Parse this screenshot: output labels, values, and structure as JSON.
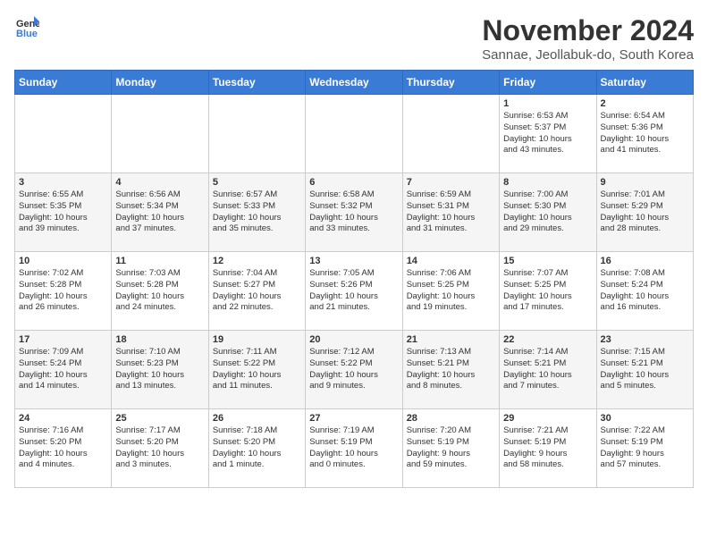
{
  "logo": {
    "general": "General",
    "blue": "Blue"
  },
  "header": {
    "month": "November 2024",
    "location": "Sannae, Jeollabuk-do, South Korea"
  },
  "weekdays": [
    "Sunday",
    "Monday",
    "Tuesday",
    "Wednesday",
    "Thursday",
    "Friday",
    "Saturday"
  ],
  "weeks": [
    [
      {
        "day": "",
        "info": ""
      },
      {
        "day": "",
        "info": ""
      },
      {
        "day": "",
        "info": ""
      },
      {
        "day": "",
        "info": ""
      },
      {
        "day": "",
        "info": ""
      },
      {
        "day": "1",
        "info": "Sunrise: 6:53 AM\nSunset: 5:37 PM\nDaylight: 10 hours\nand 43 minutes."
      },
      {
        "day": "2",
        "info": "Sunrise: 6:54 AM\nSunset: 5:36 PM\nDaylight: 10 hours\nand 41 minutes."
      }
    ],
    [
      {
        "day": "3",
        "info": "Sunrise: 6:55 AM\nSunset: 5:35 PM\nDaylight: 10 hours\nand 39 minutes."
      },
      {
        "day": "4",
        "info": "Sunrise: 6:56 AM\nSunset: 5:34 PM\nDaylight: 10 hours\nand 37 minutes."
      },
      {
        "day": "5",
        "info": "Sunrise: 6:57 AM\nSunset: 5:33 PM\nDaylight: 10 hours\nand 35 minutes."
      },
      {
        "day": "6",
        "info": "Sunrise: 6:58 AM\nSunset: 5:32 PM\nDaylight: 10 hours\nand 33 minutes."
      },
      {
        "day": "7",
        "info": "Sunrise: 6:59 AM\nSunset: 5:31 PM\nDaylight: 10 hours\nand 31 minutes."
      },
      {
        "day": "8",
        "info": "Sunrise: 7:00 AM\nSunset: 5:30 PM\nDaylight: 10 hours\nand 29 minutes."
      },
      {
        "day": "9",
        "info": "Sunrise: 7:01 AM\nSunset: 5:29 PM\nDaylight: 10 hours\nand 28 minutes."
      }
    ],
    [
      {
        "day": "10",
        "info": "Sunrise: 7:02 AM\nSunset: 5:28 PM\nDaylight: 10 hours\nand 26 minutes."
      },
      {
        "day": "11",
        "info": "Sunrise: 7:03 AM\nSunset: 5:28 PM\nDaylight: 10 hours\nand 24 minutes."
      },
      {
        "day": "12",
        "info": "Sunrise: 7:04 AM\nSunset: 5:27 PM\nDaylight: 10 hours\nand 22 minutes."
      },
      {
        "day": "13",
        "info": "Sunrise: 7:05 AM\nSunset: 5:26 PM\nDaylight: 10 hours\nand 21 minutes."
      },
      {
        "day": "14",
        "info": "Sunrise: 7:06 AM\nSunset: 5:25 PM\nDaylight: 10 hours\nand 19 minutes."
      },
      {
        "day": "15",
        "info": "Sunrise: 7:07 AM\nSunset: 5:25 PM\nDaylight: 10 hours\nand 17 minutes."
      },
      {
        "day": "16",
        "info": "Sunrise: 7:08 AM\nSunset: 5:24 PM\nDaylight: 10 hours\nand 16 minutes."
      }
    ],
    [
      {
        "day": "17",
        "info": "Sunrise: 7:09 AM\nSunset: 5:24 PM\nDaylight: 10 hours\nand 14 minutes."
      },
      {
        "day": "18",
        "info": "Sunrise: 7:10 AM\nSunset: 5:23 PM\nDaylight: 10 hours\nand 13 minutes."
      },
      {
        "day": "19",
        "info": "Sunrise: 7:11 AM\nSunset: 5:22 PM\nDaylight: 10 hours\nand 11 minutes."
      },
      {
        "day": "20",
        "info": "Sunrise: 7:12 AM\nSunset: 5:22 PM\nDaylight: 10 hours\nand 9 minutes."
      },
      {
        "day": "21",
        "info": "Sunrise: 7:13 AM\nSunset: 5:21 PM\nDaylight: 10 hours\nand 8 minutes."
      },
      {
        "day": "22",
        "info": "Sunrise: 7:14 AM\nSunset: 5:21 PM\nDaylight: 10 hours\nand 7 minutes."
      },
      {
        "day": "23",
        "info": "Sunrise: 7:15 AM\nSunset: 5:21 PM\nDaylight: 10 hours\nand 5 minutes."
      }
    ],
    [
      {
        "day": "24",
        "info": "Sunrise: 7:16 AM\nSunset: 5:20 PM\nDaylight: 10 hours\nand 4 minutes."
      },
      {
        "day": "25",
        "info": "Sunrise: 7:17 AM\nSunset: 5:20 PM\nDaylight: 10 hours\nand 3 minutes."
      },
      {
        "day": "26",
        "info": "Sunrise: 7:18 AM\nSunset: 5:20 PM\nDaylight: 10 hours\nand 1 minute."
      },
      {
        "day": "27",
        "info": "Sunrise: 7:19 AM\nSunset: 5:19 PM\nDaylight: 10 hours\nand 0 minutes."
      },
      {
        "day": "28",
        "info": "Sunrise: 7:20 AM\nSunset: 5:19 PM\nDaylight: 9 hours\nand 59 minutes."
      },
      {
        "day": "29",
        "info": "Sunrise: 7:21 AM\nSunset: 5:19 PM\nDaylight: 9 hours\nand 58 minutes."
      },
      {
        "day": "30",
        "info": "Sunrise: 7:22 AM\nSunset: 5:19 PM\nDaylight: 9 hours\nand 57 minutes."
      }
    ]
  ]
}
